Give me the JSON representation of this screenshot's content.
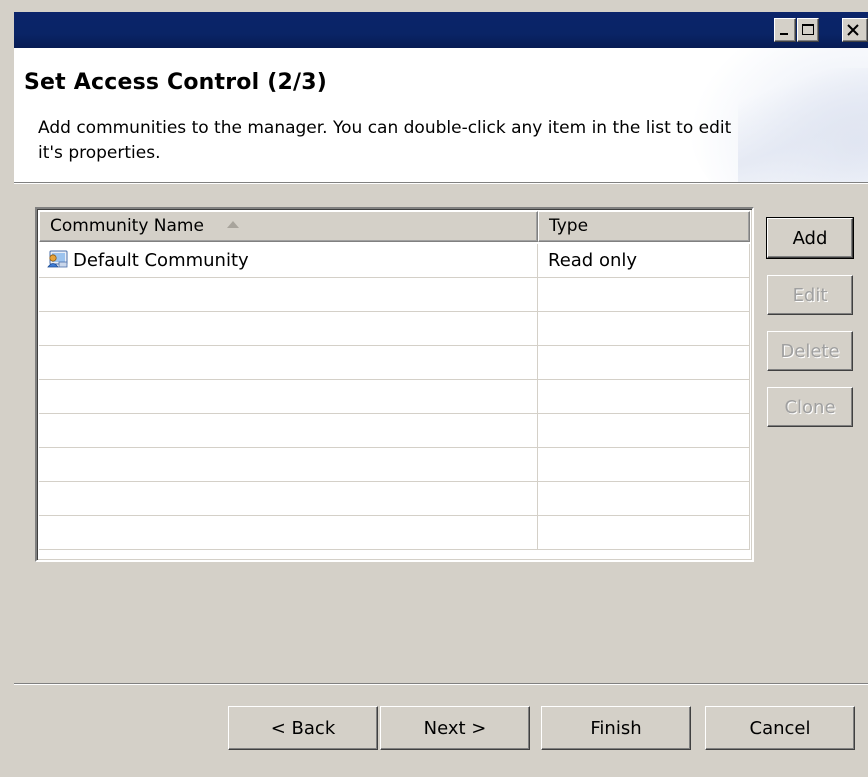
{
  "window": {
    "minimize_icon": "minimize-icon",
    "maximize_icon": "maximize-icon",
    "close_icon": "close-icon"
  },
  "header": {
    "title": "Set Access Control (2/3)",
    "description": "Add communities to the manager. You can double-click any item in the list to edit it's properties."
  },
  "table": {
    "columns": [
      {
        "label": "Community Name",
        "sort": "ascending"
      },
      {
        "label": "Type"
      }
    ],
    "rows": [
      {
        "icon": "community-icon",
        "name": "Default Community",
        "type": "Read only"
      },
      {
        "name": "",
        "type": ""
      },
      {
        "name": "",
        "type": ""
      },
      {
        "name": "",
        "type": ""
      },
      {
        "name": "",
        "type": ""
      },
      {
        "name": "",
        "type": ""
      },
      {
        "name": "",
        "type": ""
      },
      {
        "name": "",
        "type": ""
      },
      {
        "name": "",
        "type": ""
      }
    ]
  },
  "side_buttons": {
    "add": "Add",
    "edit": "Edit",
    "delete": "Delete",
    "clone": "Clone"
  },
  "footer": {
    "back": "< Back",
    "next": "Next >",
    "finish": "Finish",
    "cancel": "Cancel"
  },
  "colors": {
    "titlebar": "#0a2466",
    "dialog_bg": "#d4d0c8",
    "header_bg": "#ffffff",
    "disabled_text": "#a0a0a0"
  }
}
